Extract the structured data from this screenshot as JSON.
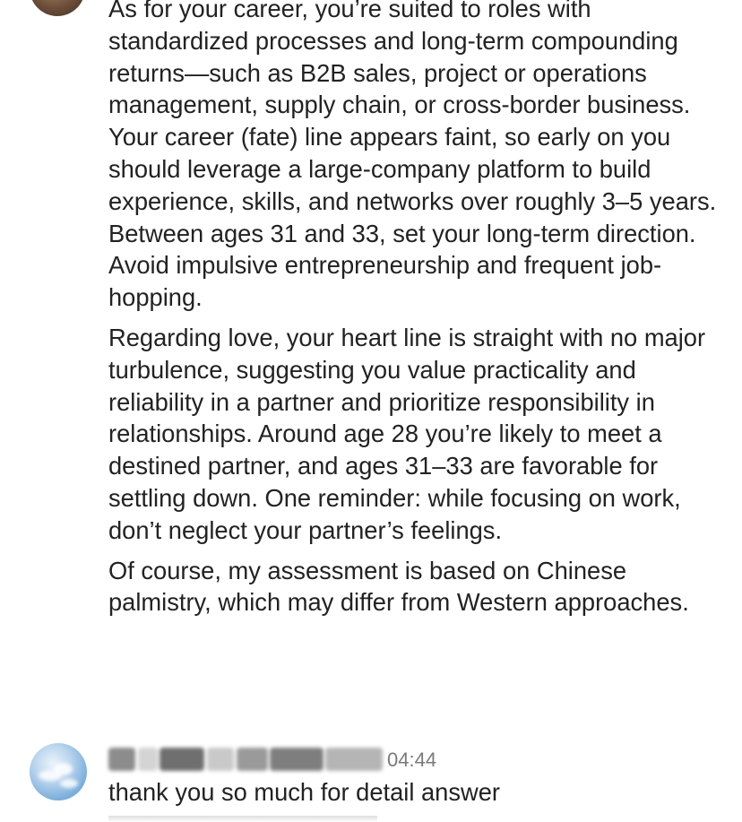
{
  "message": {
    "paragraphs": [
      "As for your career, you’re suited to roles with standardized processes and long-term compounding returns—such as B2B sales, project or operations management, supply chain, or cross-border business. Your career (fate) line appears faint, so early on you should leverage a large-company platform to build experience, skills, and networks over roughly 3–5 years. Between ages 31 and 33, set your long-term direction. Avoid impulsive entrepreneurship and frequent job-hopping.",
      "Regarding love, your heart line is straight with no major turbulence, suggesting you value practicality and reliability in a partner and prioritize responsibility in relationships. Around age 28 you’re likely to meet a destined partner, and ages 31–33 are favorable for settling down. One reminder: while focusing on work, don’t neglect your partner’s feelings.",
      "Of course, my assessment is based on Chinese palmistry, which may differ from Western approaches."
    ]
  },
  "reply": {
    "time": "04:44",
    "text": "thank you so much for detail answer"
  }
}
